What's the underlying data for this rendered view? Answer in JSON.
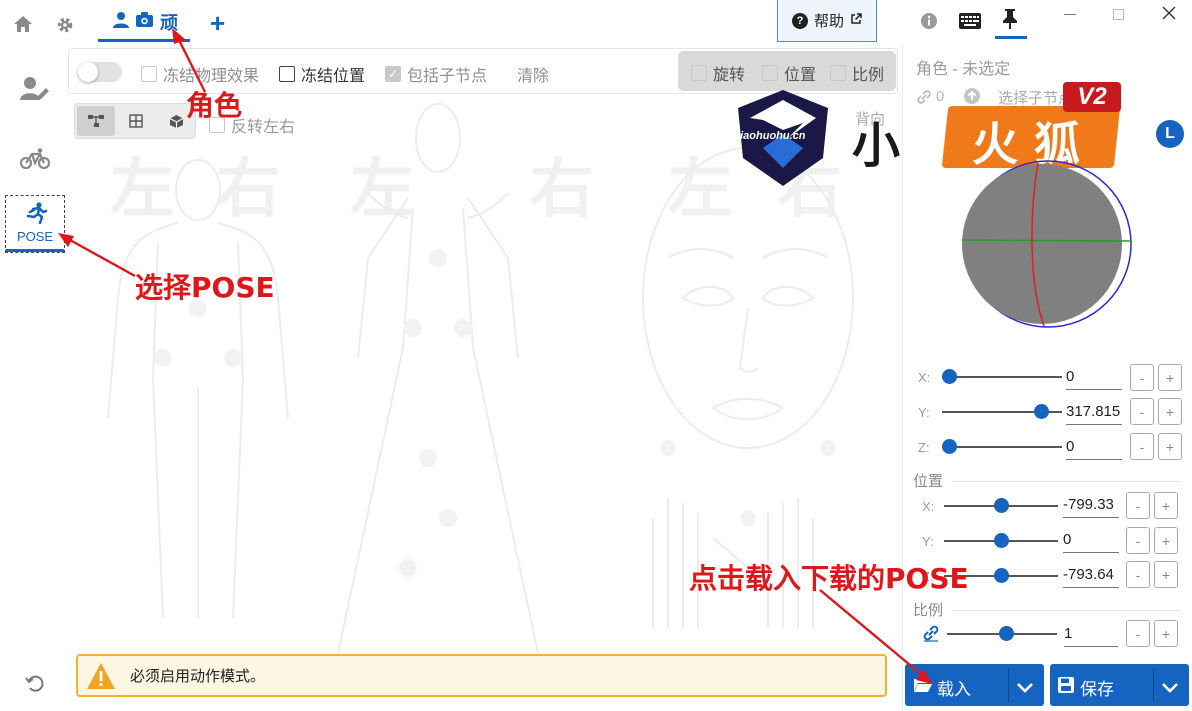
{
  "topbar": {
    "active_tab_label": "顽",
    "help_label": "帮助"
  },
  "sidebar": {
    "pose_label": "POSE"
  },
  "toolbar": {
    "freeze_physics": "冻结物理效果",
    "freeze_position": "冻结位置",
    "include_children": "包括子节点",
    "clear": "清除",
    "rotate": "旋转",
    "position": "位置",
    "scale": "比例"
  },
  "canvas": {
    "flip_lr": "反转左右",
    "back_label": "背向",
    "watermark_glyphs": [
      "左",
      "右",
      "左",
      "右",
      "左",
      "右"
    ]
  },
  "status": {
    "warning_text": "必须启用动作模式。"
  },
  "panel": {
    "title": "角色 - 未选定",
    "link_count": "0",
    "select_children": "选择子节点旋转",
    "badge": "L",
    "rotation": {
      "x": {
        "label": "X:",
        "value": "0",
        "fraction": 0.0
      },
      "y": {
        "label": "Y:",
        "value": "317.815",
        "fraction": 0.88
      },
      "z": {
        "label": "Z:",
        "value": "0",
        "fraction": 0.0
      }
    },
    "position_title": "位置",
    "position": {
      "x": {
        "label": "X:",
        "value": "-799.33",
        "fraction": 0.5
      },
      "y": {
        "label": "Y:",
        "value": "0",
        "fraction": 0.5
      },
      "z": {
        "label": "Z:",
        "value": "-793.64",
        "fraction": 0.5
      }
    },
    "scale_title": "比例",
    "scale": {
      "value": "1",
      "fraction": 0.55
    },
    "minus": "-",
    "plus": "+",
    "load_label": "载入",
    "save_label": "保存"
  },
  "annotations": {
    "role": "角色",
    "select_pose": "选择POSE",
    "load_hint": "点击载入下载的POSE"
  },
  "watermark": {
    "site": "xiaohuohu.cn",
    "brand_small": "小",
    "brand_main": "火狐",
    "version": "V2"
  },
  "colors": {
    "accent": "#1565c0",
    "annotation_red": "#e0161b",
    "warning_border": "#f0b431",
    "banner_orange": "#f07a1a"
  }
}
